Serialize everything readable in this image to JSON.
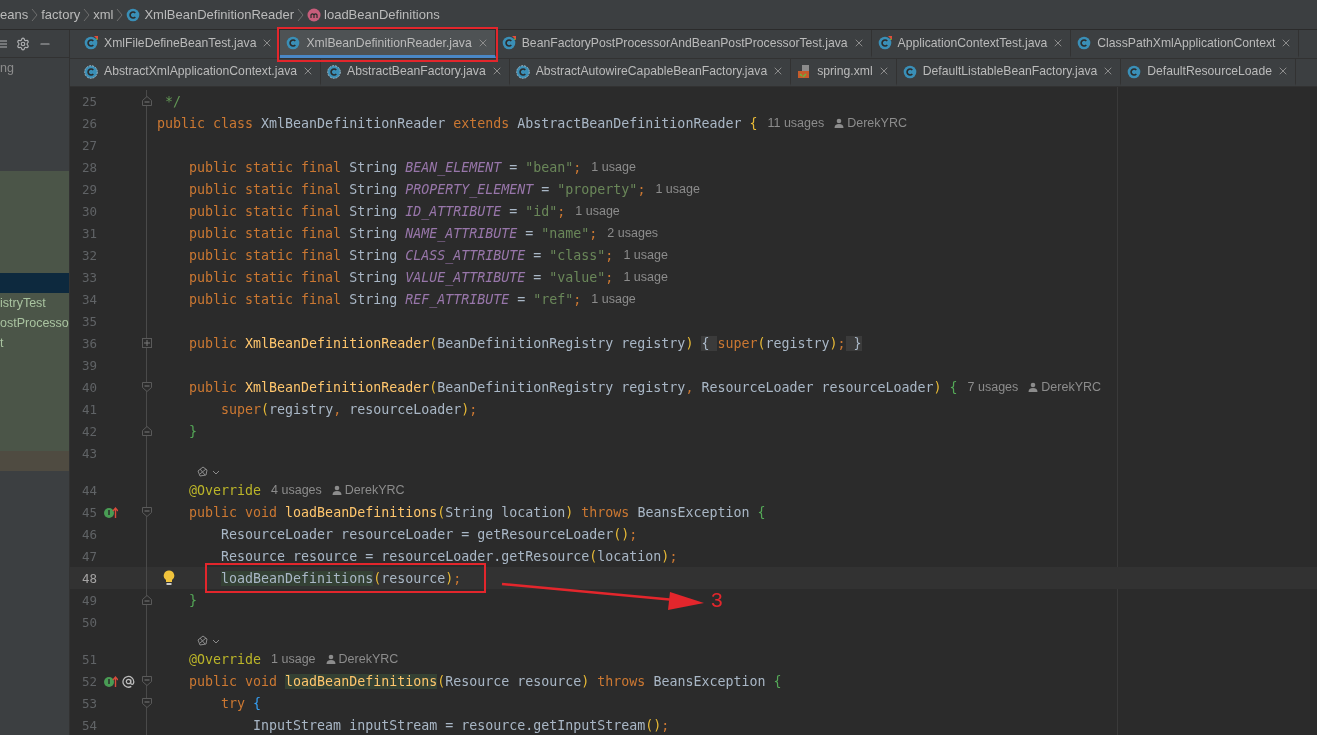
{
  "breadcrumb": [
    {
      "text": "eans"
    },
    {
      "text": "factory"
    },
    {
      "text": "xml"
    },
    {
      "text": "XmlBeanDefinitionReader",
      "kind": "class"
    },
    {
      "text": "loadBeanDefinitions",
      "kind": "method"
    }
  ],
  "project_panel": {
    "rows": [
      {
        "text": "ng",
        "selected": false,
        "kind": "normal"
      },
      {
        "selected": true,
        "kind": "modified"
      },
      {
        "text": "istryTest",
        "selected": false,
        "kind": "modified"
      },
      {
        "text": "ostProcesso",
        "selected": false,
        "kind": "modified"
      },
      {
        "text": "t",
        "selected": false,
        "kind": "modified"
      },
      {
        "selected": false,
        "kind": "ignored"
      }
    ]
  },
  "tab_rows": [
    [
      {
        "label": "XmlFileDefineBeanTest.java",
        "kind": "test",
        "selected": false
      },
      {
        "label": "XmlBeanDefinitionReader.java",
        "kind": "class",
        "selected": true
      },
      {
        "label": "BeanFactoryPostProcessorAndBeanPostProcessorTest.java",
        "kind": "test",
        "selected": false
      },
      {
        "label": "ApplicationContextTest.java",
        "kind": "test",
        "selected": false
      },
      {
        "label": "ClassPathXmlApplicationContext",
        "kind": "class",
        "selected": false
      }
    ],
    [
      {
        "label": "AbstractXmlApplicationContext.java",
        "kind": "abstract",
        "selected": false
      },
      {
        "label": "AbstractBeanFactory.java",
        "kind": "abstract",
        "selected": false
      },
      {
        "label": "AbstractAutowireCapableBeanFactory.java",
        "kind": "abstract",
        "selected": false
      },
      {
        "label": "spring.xml",
        "kind": "xml",
        "selected": false
      },
      {
        "label": "DefaultListableBeanFactory.java",
        "kind": "class",
        "selected": false
      },
      {
        "label": "DefaultResourceLoade",
        "kind": "class",
        "selected": false
      }
    ]
  ],
  "editor": {
    "lines": [
      {
        "number": "25",
        "fold": {
          "kind": "end"
        },
        "tokens": [
          {
            "kind": "comment",
            "text": " */"
          }
        ]
      },
      {
        "number": "26",
        "tokens": [
          {
            "kind": "kw",
            "text": "public class "
          },
          {
            "kind": "plain",
            "text": "XmlBeanDefinitionReader "
          },
          {
            "kind": "kw",
            "text": "extends "
          },
          {
            "kind": "plain",
            "text": "AbstractBeanDefinitionReader "
          },
          {
            "kind": "b1",
            "text": "{"
          }
        ],
        "usages": "11 usages",
        "author": "DerekYRC"
      },
      {
        "number": "27"
      },
      {
        "number": "28",
        "tokens": [
          {
            "kind": "kw",
            "text": "    public static final "
          },
          {
            "kind": "plain",
            "text": "String "
          },
          {
            "kind": "const",
            "text": "BEAN_ELEMENT"
          },
          {
            "kind": "plain",
            "text": " = "
          },
          {
            "kind": "str",
            "text": "\"bean\""
          },
          {
            "kind": "kw",
            "text": ";"
          }
        ],
        "usages": "1 usage"
      },
      {
        "number": "29",
        "tokens": [
          {
            "kind": "kw",
            "text": "    public static final "
          },
          {
            "kind": "plain",
            "text": "String "
          },
          {
            "kind": "const",
            "text": "PROPERTY_ELEMENT"
          },
          {
            "kind": "plain",
            "text": " = "
          },
          {
            "kind": "str",
            "text": "\"property\""
          },
          {
            "kind": "kw",
            "text": ";"
          }
        ],
        "usages": "1 usage"
      },
      {
        "number": "30",
        "tokens": [
          {
            "kind": "kw",
            "text": "    public static final "
          },
          {
            "kind": "plain",
            "text": "String "
          },
          {
            "kind": "const",
            "text": "ID_ATTRIBUTE"
          },
          {
            "kind": "plain",
            "text": " = "
          },
          {
            "kind": "str",
            "text": "\"id\""
          },
          {
            "kind": "kw",
            "text": ";"
          }
        ],
        "usages": "1 usage"
      },
      {
        "number": "31",
        "tokens": [
          {
            "kind": "kw",
            "text": "    public static final "
          },
          {
            "kind": "plain",
            "text": "String "
          },
          {
            "kind": "const",
            "text": "NAME_ATTRIBUTE"
          },
          {
            "kind": "plain",
            "text": " = "
          },
          {
            "kind": "str",
            "text": "\"name\""
          },
          {
            "kind": "kw",
            "text": ";"
          }
        ],
        "usages": "2 usages"
      },
      {
        "number": "32",
        "tokens": [
          {
            "kind": "kw",
            "text": "    public static final "
          },
          {
            "kind": "plain",
            "text": "String "
          },
          {
            "kind": "const",
            "text": "CLASS_ATTRIBUTE"
          },
          {
            "kind": "plain",
            "text": " = "
          },
          {
            "kind": "str",
            "text": "\"class\""
          },
          {
            "kind": "kw",
            "text": ";"
          }
        ],
        "usages": "1 usage"
      },
      {
        "number": "33",
        "tokens": [
          {
            "kind": "kw",
            "text": "    public static final "
          },
          {
            "kind": "plain",
            "text": "String "
          },
          {
            "kind": "const",
            "text": "VALUE_ATTRIBUTE"
          },
          {
            "kind": "plain",
            "text": " = "
          },
          {
            "kind": "str",
            "text": "\"value\""
          },
          {
            "kind": "kw",
            "text": ";"
          }
        ],
        "usages": "1 usage"
      },
      {
        "number": "34",
        "tokens": [
          {
            "kind": "kw",
            "text": "    public static final "
          },
          {
            "kind": "plain",
            "text": "String "
          },
          {
            "kind": "const",
            "text": "REF_ATTRIBUTE"
          },
          {
            "kind": "plain",
            "text": " = "
          },
          {
            "kind": "str",
            "text": "\"ref\""
          },
          {
            "kind": "kw",
            "text": ";"
          }
        ],
        "usages": "1 usage"
      },
      {
        "number": "35"
      },
      {
        "number": "36",
        "fold": {
          "kind": "collapsed"
        },
        "tokens": [
          {
            "kind": "kw",
            "text": "    public "
          },
          {
            "kind": "method",
            "text": "XmlBeanDefinitionReader"
          },
          {
            "kind": "b1",
            "text": "("
          },
          {
            "kind": "plain",
            "text": "BeanDefinitionRegistry registry"
          },
          {
            "kind": "b1",
            "text": ") "
          },
          {
            "kind": "folded",
            "text": "{ "
          },
          {
            "kind": "kw",
            "text": "super"
          },
          {
            "kind": "b1",
            "text": "("
          },
          {
            "kind": "plain",
            "text": "registry"
          },
          {
            "kind": "b1",
            "text": ")"
          },
          {
            "kind": "kw",
            "text": ";"
          },
          {
            "kind": "folded",
            "text": " }"
          }
        ]
      },
      {
        "number": "39"
      },
      {
        "number": "40",
        "fold": {
          "kind": "start"
        },
        "tokens": [
          {
            "kind": "kw",
            "text": "    public "
          },
          {
            "kind": "method",
            "text": "XmlBeanDefinitionReader"
          },
          {
            "kind": "b1",
            "text": "("
          },
          {
            "kind": "plain",
            "text": "BeanDefinitionRegistry registry"
          },
          {
            "kind": "kw",
            "text": ","
          },
          {
            "kind": "plain",
            "text": " ResourceLoader resourceLoader"
          },
          {
            "kind": "b1",
            "text": ") "
          },
          {
            "kind": "b2",
            "text": "{"
          }
        ],
        "usages": "7 usages",
        "author": "DerekYRC"
      },
      {
        "number": "41",
        "tokens": [
          {
            "kind": "kw",
            "text": "        super"
          },
          {
            "kind": "b1",
            "text": "("
          },
          {
            "kind": "plain",
            "text": "registry"
          },
          {
            "kind": "kw",
            "text": ","
          },
          {
            "kind": "plain",
            "text": " resourceLoader"
          },
          {
            "kind": "b1",
            "text": ")"
          },
          {
            "kind": "kw",
            "text": ";"
          }
        ]
      },
      {
        "number": "42",
        "fold": {
          "kind": "end"
        },
        "tokens": [
          {
            "kind": "b2",
            "text": "    }"
          }
        ]
      },
      {
        "number": "43"
      },
      {
        "number": "44",
        "inlay_above": true,
        "tokens": [
          {
            "kind": "ann",
            "text": "    @Override"
          }
        ],
        "usages": "4 usages",
        "author": "DerekYRC"
      },
      {
        "number": "45",
        "fold": {
          "kind": "start"
        },
        "override": true,
        "tokens": [
          {
            "kind": "kw",
            "text": "    public void "
          },
          {
            "kind": "method",
            "text": "loadBeanDefinitions"
          },
          {
            "kind": "b1",
            "text": "("
          },
          {
            "kind": "plain",
            "text": "String location"
          },
          {
            "kind": "b1",
            "text": ")"
          },
          {
            "kind": "kw",
            "text": " throws "
          },
          {
            "kind": "plain",
            "text": "BeansException "
          },
          {
            "kind": "b2",
            "text": "{"
          }
        ]
      },
      {
        "number": "46",
        "tokens": [
          {
            "kind": "plain",
            "text": "        ResourceLoader resourceLoader = getResourceLoader"
          },
          {
            "kind": "b1",
            "text": "()"
          },
          {
            "kind": "kw",
            "text": ";"
          }
        ]
      },
      {
        "number": "47",
        "tokens": [
          {
            "kind": "plain",
            "text": "        Resource resource = resourceLoader.getResource"
          },
          {
            "kind": "b1",
            "text": "("
          },
          {
            "kind": "plain",
            "text": "location"
          },
          {
            "kind": "b1",
            "text": ")"
          },
          {
            "kind": "kw",
            "text": ";"
          }
        ]
      },
      {
        "number": "48",
        "current": true,
        "bulb": true,
        "tokens": [
          {
            "kind": "hl",
            "text": "        loadBeanDefinitions"
          },
          {
            "kind": "b1",
            "text": "("
          },
          {
            "kind": "plain",
            "text": "resource"
          },
          {
            "kind": "b1",
            "text": ")"
          },
          {
            "kind": "kw",
            "text": ";"
          }
        ]
      },
      {
        "number": "49",
        "fold": {
          "kind": "end"
        },
        "tokens": [
          {
            "kind": "b2",
            "text": "    }"
          }
        ]
      },
      {
        "number": "50"
      },
      {
        "number": "51",
        "inlay_above": true,
        "tokens": [
          {
            "kind": "ann",
            "text": "    @Override"
          }
        ],
        "usages": "1 usage",
        "author": "DerekYRC"
      },
      {
        "number": "52",
        "fold": {
          "kind": "start"
        },
        "override": true,
        "at": true,
        "tokens": [
          {
            "kind": "kw",
            "text": "    public void "
          },
          {
            "kind": "methodhl",
            "text": "loadBeanDefinitions"
          },
          {
            "kind": "b1",
            "text": "("
          },
          {
            "kind": "plain",
            "text": "Resource resource"
          },
          {
            "kind": "b1",
            "text": ")"
          },
          {
            "kind": "kw",
            "text": " throws "
          },
          {
            "kind": "plain",
            "text": "BeansException "
          },
          {
            "kind": "b2",
            "text": "{"
          }
        ]
      },
      {
        "number": "53",
        "fold": {
          "kind": "start"
        },
        "tokens": [
          {
            "kind": "kw",
            "text": "        try "
          },
          {
            "kind": "b3",
            "text": "{"
          }
        ]
      },
      {
        "number": "54",
        "tokens": [
          {
            "kind": "plain",
            "text": "            InputStream inputStream = resource.getInputStream"
          },
          {
            "kind": "b1",
            "text": "()"
          },
          {
            "kind": "kw",
            "text": ";"
          }
        ]
      }
    ]
  },
  "markup": {
    "label": "3"
  }
}
